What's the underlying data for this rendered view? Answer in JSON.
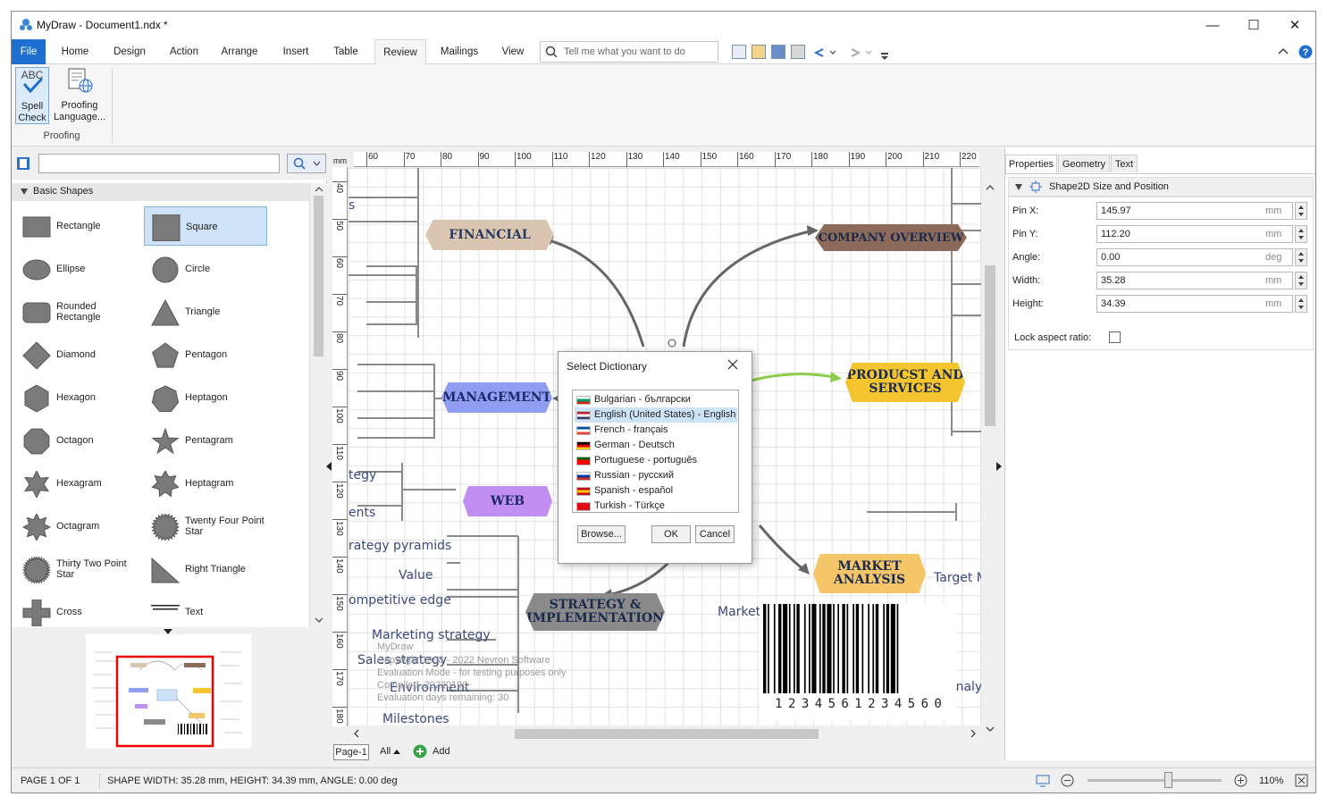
{
  "app": {
    "title": "MyDraw - Document1.ndx *"
  },
  "window_controls": {
    "minimize": "—",
    "maximize": "☐",
    "close": "✕"
  },
  "menu": {
    "file": "File",
    "home": "Home",
    "design": "Design",
    "action": "Action",
    "arrange": "Arrange",
    "insert": "Insert",
    "table": "Table",
    "review": "Review",
    "mailings": "Mailings",
    "view": "View",
    "tell_me_placeholder": "Tell me what you want to do"
  },
  "ribbon": {
    "spell_check": "Spell Check",
    "proofing_language": "Proofing Language...",
    "group_label": "Proofing"
  },
  "left_panel": {
    "category": "Basic Shapes",
    "shapes": [
      {
        "label": "Rectangle",
        "icon": "rectangle-icon"
      },
      {
        "label": "Square",
        "icon": "square-icon",
        "selected": true
      },
      {
        "label": "Ellipse",
        "icon": "ellipse-icon"
      },
      {
        "label": "Circle",
        "icon": "circle-icon"
      },
      {
        "label": "Rounded Rectangle",
        "icon": "rounded-rectangle-icon"
      },
      {
        "label": "Triangle",
        "icon": "triangle-icon"
      },
      {
        "label": "Diamond",
        "icon": "diamond-icon"
      },
      {
        "label": "Pentagon",
        "icon": "pentagon-icon"
      },
      {
        "label": "Hexagon",
        "icon": "hexagon-icon"
      },
      {
        "label": "Heptagon",
        "icon": "heptagon-icon"
      },
      {
        "label": "Octagon",
        "icon": "octagon-icon"
      },
      {
        "label": "Pentagram",
        "icon": "pentagram-icon"
      },
      {
        "label": "Hexagram",
        "icon": "hexagram-icon"
      },
      {
        "label": "Heptagram",
        "icon": "heptagram-icon"
      },
      {
        "label": "Octagram",
        "icon": "octagram-icon"
      },
      {
        "label": "Twenty Four Point Star",
        "icon": "star24-icon"
      },
      {
        "label": "Thirty Two Point Star",
        "icon": "star32-icon"
      },
      {
        "label": "Right Triangle",
        "icon": "right-triangle-icon"
      },
      {
        "label": "Cross",
        "icon": "cross-icon"
      },
      {
        "label": "Text",
        "icon": "text-icon"
      }
    ]
  },
  "ruler": {
    "unit": "mm",
    "h_ticks": [
      "60",
      "70",
      "80",
      "90",
      "100",
      "110",
      "120",
      "130",
      "140",
      "150",
      "160",
      "170",
      "180",
      "190",
      "200",
      "210",
      "220"
    ],
    "v_ticks": [
      "40",
      "50",
      "60",
      "70",
      "80",
      "90",
      "100",
      "110",
      "120",
      "130",
      "140",
      "150",
      "160",
      "170",
      "180"
    ]
  },
  "canvas": {
    "nodes": {
      "financial": "FINANCIAL",
      "company_overview": "COMPANY OVERVIEW",
      "management": "MANAGEMENT",
      "products": "PRODUCST AND SERVICES",
      "web": "WEB",
      "market": "MARKET ANALYSIS",
      "strategy": "STRATEGY & IMPLEMENTATION"
    },
    "labels": {
      "s": "s",
      "tegy": "tegy",
      "ents": "ents",
      "strategy_pyramids": "rategy pyramids",
      "value": "Value",
      "competitive_edge": "ompetitive edge",
      "marketing_strategy": "Marketing strategy",
      "sales_strategy": "Sales strategy",
      "environment": "Environment",
      "milestones": "Milestones",
      "target_m": "Target M",
      "market_seg": "Market segmentation",
      "analysi": "Analysi"
    },
    "watermark": {
      "l1": "MyDraw",
      "l2": "Copyright 1998 - 2022 Nevron Software",
      "l3": "Evaluation Mode - for testing purposes only",
      "l4": "Compiled: 20220190",
      "l5": "Evaluation days remaining: 30"
    },
    "barcode_text": "1 2 3 4 5 6 1 2 3 4 5 6 0"
  },
  "dialog": {
    "title": "Select Dictionary",
    "items": [
      {
        "label": "Bulgarian - български",
        "flag_colors": [
          "#ffffff",
          "#00966e",
          "#d62612"
        ]
      },
      {
        "label": "English (United States) - English",
        "flag_colors": [
          "#b22234",
          "#ffffff",
          "#3c3b6e"
        ],
        "selected": true
      },
      {
        "label": "French - français",
        "flag_colors": [
          "#0055a4",
          "#ffffff",
          "#ef4135"
        ]
      },
      {
        "label": "German - Deutsch",
        "flag_colors": [
          "#000000",
          "#dd0000",
          "#ffce00"
        ]
      },
      {
        "label": "Portuguese - português",
        "flag_colors": [
          "#006600",
          "#ff0000",
          "#ff0000"
        ]
      },
      {
        "label": "Russian - русский",
        "flag_colors": [
          "#ffffff",
          "#0039a6",
          "#d52b1e"
        ]
      },
      {
        "label": "Spanish - español",
        "flag_colors": [
          "#c60b1e",
          "#ffc400",
          "#c60b1e"
        ]
      },
      {
        "label": "Turkish - Türkçe",
        "flag_colors": [
          "#e30a17",
          "#e30a17",
          "#e30a17"
        ]
      }
    ],
    "browse": "Browse...",
    "ok": "OK",
    "cancel": "Cancel"
  },
  "page_tabs": {
    "page": "Page-1",
    "all": "All",
    "add": "Add"
  },
  "properties": {
    "tabs": [
      "Properties",
      "Geometry",
      "Text"
    ],
    "section": "Shape2D Size and Position",
    "rows": [
      {
        "label": "Pin X:",
        "value": "145.97",
        "unit": "mm"
      },
      {
        "label": "Pin Y:",
        "value": "112.20",
        "unit": "mm"
      },
      {
        "label": "Angle:",
        "value": "0.00",
        "unit": "deg"
      },
      {
        "label": "Width:",
        "value": "35.28",
        "unit": "mm"
      },
      {
        "label": "Height:",
        "value": "34.39",
        "unit": "mm"
      }
    ],
    "lock_aspect": "Lock aspect ratio:"
  },
  "status": {
    "page": "PAGE 1 OF 1",
    "shape": "SHAPE WIDTH: 35.28 mm, HEIGHT: 34.39 mm, ANGLE: 0.00 deg",
    "zoom": "110%",
    "zoom_level": 0.6
  },
  "colors": {
    "accent": "#1e6fd0",
    "financial": "#d9c5b0",
    "company": "#8c6a5a",
    "management": "#8f9ef0",
    "products": "#f5c530",
    "web": "#c18ff0",
    "market": "#f5c56a",
    "strategy": "#8a8a8a"
  }
}
